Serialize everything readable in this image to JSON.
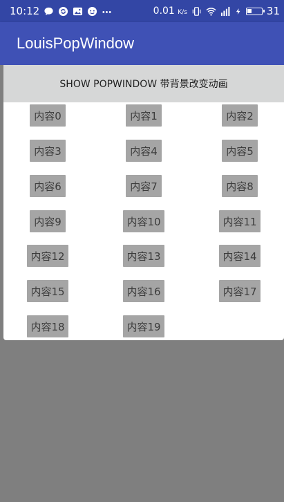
{
  "statusbar": {
    "time": "10:12",
    "speed": "0.01",
    "speed_unit": "K/s",
    "battery": "31",
    "battery_level": 0.31,
    "left_icons": [
      "chat-icon",
      "sync-icon",
      "photo-icon",
      "emoji-icon",
      "more-icon"
    ],
    "right_icons": [
      "vibrate-icon",
      "wifi-icon",
      "signal-icon",
      "charging-icon",
      "battery-icon"
    ]
  },
  "app": {
    "title": "LouisPopWindow",
    "colors": {
      "primary": "#3f51b5",
      "primary_dark": "#3346a5",
      "dim": "#7f7f7f"
    }
  },
  "main": {
    "show_button_label": "SHOW POPWINDOW 带背景改变动画"
  },
  "popup": {
    "items": [
      "内容0",
      "内容1",
      "内容2",
      "内容3",
      "内容4",
      "内容5",
      "内容6",
      "内容7",
      "内容8",
      "内容9",
      "内容10",
      "内容11",
      "内容12",
      "内容13",
      "内容14",
      "内容15",
      "内容16",
      "内容17",
      "内容18",
      "内容19"
    ]
  }
}
